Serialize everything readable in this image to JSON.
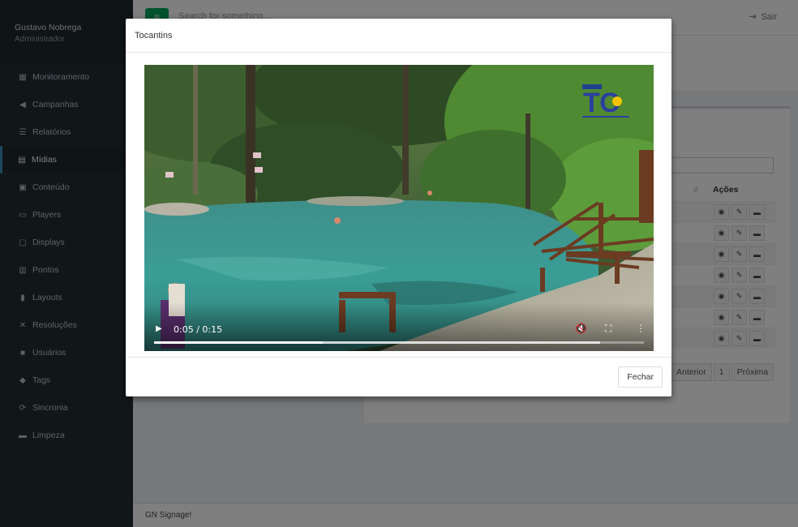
{
  "sidebar": {
    "user_name": "Gustavo Nobrega",
    "user_role": "Administrador",
    "items": [
      {
        "label": "Monitoramento",
        "icon": "grid-icon",
        "glyph": "▦"
      },
      {
        "label": "Campanhas",
        "icon": "megaphone-icon",
        "glyph": "◀"
      },
      {
        "label": "Relatórios",
        "icon": "list-icon",
        "glyph": "☰"
      },
      {
        "label": "Mídias",
        "icon": "film-icon",
        "glyph": "▤"
      },
      {
        "label": "Conteúdo",
        "icon": "card-icon",
        "glyph": "▣"
      },
      {
        "label": "Players",
        "icon": "laptop-icon",
        "glyph": "▭"
      },
      {
        "label": "Displays",
        "icon": "monitor-icon",
        "glyph": "▢"
      },
      {
        "label": "Pontos",
        "icon": "building-icon",
        "glyph": "▥"
      },
      {
        "label": "Layouts",
        "icon": "columns-icon",
        "glyph": "▮"
      },
      {
        "label": "Resoluções",
        "icon": "expand-icon",
        "glyph": "✕"
      },
      {
        "label": "Usuários",
        "icon": "lock-icon",
        "glyph": "■"
      },
      {
        "label": "Tags",
        "icon": "tag-icon",
        "glyph": "◆"
      },
      {
        "label": "Sincronia",
        "icon": "refresh-icon",
        "glyph": "⟳"
      },
      {
        "label": "Limpeza",
        "icon": "trash-icon",
        "glyph": "▬"
      }
    ],
    "active_index": 3
  },
  "header": {
    "menu_glyph": "≡",
    "search_placeholder": "Search for something...",
    "logout_label": "Sair",
    "logout_glyph": "⇥"
  },
  "table": {
    "actions_header": "Ações",
    "row_actions": [
      "view-icon",
      "edit-icon",
      "delete-icon"
    ],
    "row_glyphs": [
      "◉",
      "✎",
      "▬"
    ],
    "row_count": 7,
    "sort_glyph": "⇵"
  },
  "pagination": {
    "prev": "Anterior",
    "current": "1",
    "next": "Próxima"
  },
  "footer": {
    "text": "GN Signage!"
  },
  "modal": {
    "title": "Tocantins",
    "close_label": "Fechar"
  },
  "video": {
    "play_glyph": "▶",
    "current_time": "0:05",
    "duration": "0:15",
    "time_display": "0:05 / 0:15",
    "volume_glyph": "🔇",
    "fullscreen_glyph": "⛶",
    "more_glyph": "⋮",
    "progress": 0.345,
    "buffered": 0.91,
    "logo_text": "TO"
  }
}
